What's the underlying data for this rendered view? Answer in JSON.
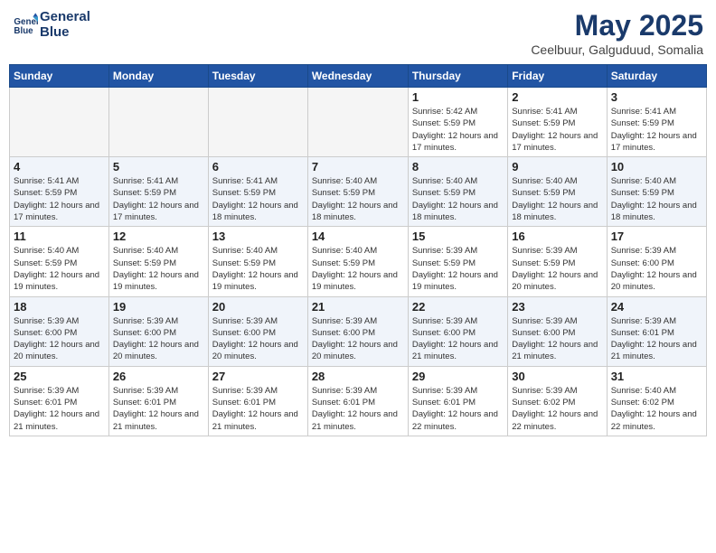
{
  "header": {
    "logo_line1": "General",
    "logo_line2": "Blue",
    "month_title": "May 2025",
    "subtitle": "Ceelbuur, Galguduud, Somalia"
  },
  "weekdays": [
    "Sunday",
    "Monday",
    "Tuesday",
    "Wednesday",
    "Thursday",
    "Friday",
    "Saturday"
  ],
  "weeks": [
    [
      {
        "day": "",
        "empty": true
      },
      {
        "day": "",
        "empty": true
      },
      {
        "day": "",
        "empty": true
      },
      {
        "day": "",
        "empty": true
      },
      {
        "day": "1",
        "sunrise": "5:42 AM",
        "sunset": "5:59 PM",
        "daylight": "12 hours and 17 minutes."
      },
      {
        "day": "2",
        "sunrise": "5:41 AM",
        "sunset": "5:59 PM",
        "daylight": "12 hours and 17 minutes."
      },
      {
        "day": "3",
        "sunrise": "5:41 AM",
        "sunset": "5:59 PM",
        "daylight": "12 hours and 17 minutes."
      }
    ],
    [
      {
        "day": "4",
        "sunrise": "5:41 AM",
        "sunset": "5:59 PM",
        "daylight": "12 hours and 17 minutes."
      },
      {
        "day": "5",
        "sunrise": "5:41 AM",
        "sunset": "5:59 PM",
        "daylight": "12 hours and 17 minutes."
      },
      {
        "day": "6",
        "sunrise": "5:41 AM",
        "sunset": "5:59 PM",
        "daylight": "12 hours and 18 minutes."
      },
      {
        "day": "7",
        "sunrise": "5:40 AM",
        "sunset": "5:59 PM",
        "daylight": "12 hours and 18 minutes."
      },
      {
        "day": "8",
        "sunrise": "5:40 AM",
        "sunset": "5:59 PM",
        "daylight": "12 hours and 18 minutes."
      },
      {
        "day": "9",
        "sunrise": "5:40 AM",
        "sunset": "5:59 PM",
        "daylight": "12 hours and 18 minutes."
      },
      {
        "day": "10",
        "sunrise": "5:40 AM",
        "sunset": "5:59 PM",
        "daylight": "12 hours and 18 minutes."
      }
    ],
    [
      {
        "day": "11",
        "sunrise": "5:40 AM",
        "sunset": "5:59 PM",
        "daylight": "12 hours and 19 minutes."
      },
      {
        "day": "12",
        "sunrise": "5:40 AM",
        "sunset": "5:59 PM",
        "daylight": "12 hours and 19 minutes."
      },
      {
        "day": "13",
        "sunrise": "5:40 AM",
        "sunset": "5:59 PM",
        "daylight": "12 hours and 19 minutes."
      },
      {
        "day": "14",
        "sunrise": "5:40 AM",
        "sunset": "5:59 PM",
        "daylight": "12 hours and 19 minutes."
      },
      {
        "day": "15",
        "sunrise": "5:39 AM",
        "sunset": "5:59 PM",
        "daylight": "12 hours and 19 minutes."
      },
      {
        "day": "16",
        "sunrise": "5:39 AM",
        "sunset": "5:59 PM",
        "daylight": "12 hours and 20 minutes."
      },
      {
        "day": "17",
        "sunrise": "5:39 AM",
        "sunset": "6:00 PM",
        "daylight": "12 hours and 20 minutes."
      }
    ],
    [
      {
        "day": "18",
        "sunrise": "5:39 AM",
        "sunset": "6:00 PM",
        "daylight": "12 hours and 20 minutes."
      },
      {
        "day": "19",
        "sunrise": "5:39 AM",
        "sunset": "6:00 PM",
        "daylight": "12 hours and 20 minutes."
      },
      {
        "day": "20",
        "sunrise": "5:39 AM",
        "sunset": "6:00 PM",
        "daylight": "12 hours and 20 minutes."
      },
      {
        "day": "21",
        "sunrise": "5:39 AM",
        "sunset": "6:00 PM",
        "daylight": "12 hours and 20 minutes."
      },
      {
        "day": "22",
        "sunrise": "5:39 AM",
        "sunset": "6:00 PM",
        "daylight": "12 hours and 21 minutes."
      },
      {
        "day": "23",
        "sunrise": "5:39 AM",
        "sunset": "6:00 PM",
        "daylight": "12 hours and 21 minutes."
      },
      {
        "day": "24",
        "sunrise": "5:39 AM",
        "sunset": "6:01 PM",
        "daylight": "12 hours and 21 minutes."
      }
    ],
    [
      {
        "day": "25",
        "sunrise": "5:39 AM",
        "sunset": "6:01 PM",
        "daylight": "12 hours and 21 minutes."
      },
      {
        "day": "26",
        "sunrise": "5:39 AM",
        "sunset": "6:01 PM",
        "daylight": "12 hours and 21 minutes."
      },
      {
        "day": "27",
        "sunrise": "5:39 AM",
        "sunset": "6:01 PM",
        "daylight": "12 hours and 21 minutes."
      },
      {
        "day": "28",
        "sunrise": "5:39 AM",
        "sunset": "6:01 PM",
        "daylight": "12 hours and 21 minutes."
      },
      {
        "day": "29",
        "sunrise": "5:39 AM",
        "sunset": "6:01 PM",
        "daylight": "12 hours and 22 minutes."
      },
      {
        "day": "30",
        "sunrise": "5:39 AM",
        "sunset": "6:02 PM",
        "daylight": "12 hours and 22 minutes."
      },
      {
        "day": "31",
        "sunrise": "5:40 AM",
        "sunset": "6:02 PM",
        "daylight": "12 hours and 22 minutes."
      }
    ]
  ]
}
